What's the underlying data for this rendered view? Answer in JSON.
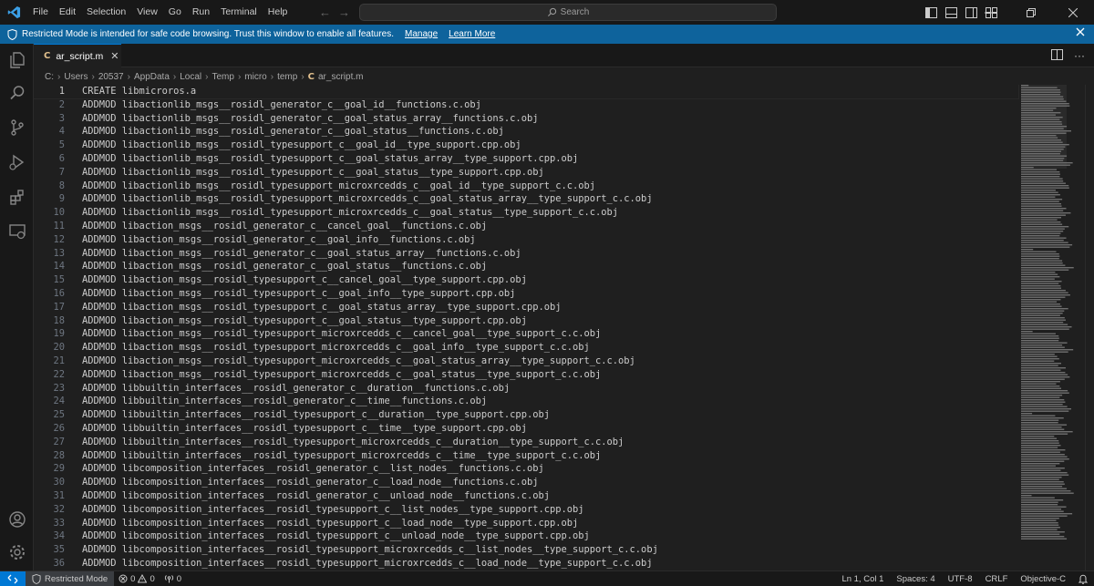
{
  "titlebar": {
    "menu": [
      "File",
      "Edit",
      "Selection",
      "View",
      "Go",
      "Run",
      "Terminal",
      "Help"
    ],
    "search_placeholder": "Search"
  },
  "banner": {
    "message": "Restricted Mode is intended for safe code browsing. Trust this window to enable all features.",
    "manage_label": "Manage",
    "learn_more_label": "Learn More"
  },
  "tab": {
    "badge": "C",
    "filename": "ar_script.m"
  },
  "breadcrumb": [
    "C:",
    "Users",
    "20537",
    "AppData",
    "Local",
    "Temp",
    "micro",
    "temp"
  ],
  "breadcrumb_file": "ar_script.m",
  "editor": {
    "lines": [
      "CREATE libmicroros.a",
      "ADDMOD libactionlib_msgs__rosidl_generator_c__goal_id__functions.c.obj",
      "ADDMOD libactionlib_msgs__rosidl_generator_c__goal_status_array__functions.c.obj",
      "ADDMOD libactionlib_msgs__rosidl_generator_c__goal_status__functions.c.obj",
      "ADDMOD libactionlib_msgs__rosidl_typesupport_c__goal_id__type_support.cpp.obj",
      "ADDMOD libactionlib_msgs__rosidl_typesupport_c__goal_status_array__type_support.cpp.obj",
      "ADDMOD libactionlib_msgs__rosidl_typesupport_c__goal_status__type_support.cpp.obj",
      "ADDMOD libactionlib_msgs__rosidl_typesupport_microxrcedds_c__goal_id__type_support_c.c.obj",
      "ADDMOD libactionlib_msgs__rosidl_typesupport_microxrcedds_c__goal_status_array__type_support_c.c.obj",
      "ADDMOD libactionlib_msgs__rosidl_typesupport_microxrcedds_c__goal_status__type_support_c.c.obj",
      "ADDMOD libaction_msgs__rosidl_generator_c__cancel_goal__functions.c.obj",
      "ADDMOD libaction_msgs__rosidl_generator_c__goal_info__functions.c.obj",
      "ADDMOD libaction_msgs__rosidl_generator_c__goal_status_array__functions.c.obj",
      "ADDMOD libaction_msgs__rosidl_generator_c__goal_status__functions.c.obj",
      "ADDMOD libaction_msgs__rosidl_typesupport_c__cancel_goal__type_support.cpp.obj",
      "ADDMOD libaction_msgs__rosidl_typesupport_c__goal_info__type_support.cpp.obj",
      "ADDMOD libaction_msgs__rosidl_typesupport_c__goal_status_array__type_support.cpp.obj",
      "ADDMOD libaction_msgs__rosidl_typesupport_c__goal_status__type_support.cpp.obj",
      "ADDMOD libaction_msgs__rosidl_typesupport_microxrcedds_c__cancel_goal__type_support_c.c.obj",
      "ADDMOD libaction_msgs__rosidl_typesupport_microxrcedds_c__goal_info__type_support_c.c.obj",
      "ADDMOD libaction_msgs__rosidl_typesupport_microxrcedds_c__goal_status_array__type_support_c.c.obj",
      "ADDMOD libaction_msgs__rosidl_typesupport_microxrcedds_c__goal_status__type_support_c.c.obj",
      "ADDMOD libbuiltin_interfaces__rosidl_generator_c__duration__functions.c.obj",
      "ADDMOD libbuiltin_interfaces__rosidl_generator_c__time__functions.c.obj",
      "ADDMOD libbuiltin_interfaces__rosidl_typesupport_c__duration__type_support.cpp.obj",
      "ADDMOD libbuiltin_interfaces__rosidl_typesupport_c__time__type_support.cpp.obj",
      "ADDMOD libbuiltin_interfaces__rosidl_typesupport_microxrcedds_c__duration__type_support_c.c.obj",
      "ADDMOD libbuiltin_interfaces__rosidl_typesupport_microxrcedds_c__time__type_support_c.c.obj",
      "ADDMOD libcomposition_interfaces__rosidl_generator_c__list_nodes__functions.c.obj",
      "ADDMOD libcomposition_interfaces__rosidl_generator_c__load_node__functions.c.obj",
      "ADDMOD libcomposition_interfaces__rosidl_generator_c__unload_node__functions.c.obj",
      "ADDMOD libcomposition_interfaces__rosidl_typesupport_c__list_nodes__type_support.cpp.obj",
      "ADDMOD libcomposition_interfaces__rosidl_typesupport_c__load_node__type_support.cpp.obj",
      "ADDMOD libcomposition_interfaces__rosidl_typesupport_c__unload_node__type_support.cpp.obj",
      "ADDMOD libcomposition_interfaces__rosidl_typesupport_microxrcedds_c__list_nodes__type_support_c.c.obj",
      "ADDMOD libcomposition_interfaces__rosidl_typesupport_microxrcedds_c__load_node__type_support_c.c.obj"
    ]
  },
  "statusbar": {
    "restricted_label": "Restricted Mode",
    "errors": "0",
    "warnings": "0",
    "ports": "0",
    "position": "Ln 1, Col 1",
    "spaces": "Spaces: 4",
    "encoding": "UTF-8",
    "eol": "CRLF",
    "language": "Objective-C"
  },
  "colors": {
    "accent": "#0078d4",
    "banner": "#0e639c",
    "c_badge": "#e2c08d"
  }
}
